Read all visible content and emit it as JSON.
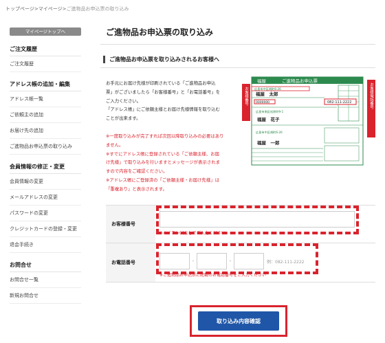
{
  "breadcrumb": {
    "home": "トップページ",
    "mypage": "マイページ",
    "current": "ご進物品お申込票の取り込み",
    "sep": ">"
  },
  "sidebar": {
    "top_button": "マイページトップへ",
    "sections": [
      {
        "title": "ご注文履歴",
        "items": [
          "ご注文履歴"
        ]
      },
      {
        "title": "アドレス帳の追加・編集",
        "items": [
          "アドレス帳一覧",
          "ご依頼主の追加",
          "お届け先の追加",
          "ご進物品お申込票の取り込み"
        ]
      },
      {
        "title": "会員情報の修正・変更",
        "items": [
          "会員情報の変更",
          "メールアドレスの変更",
          "パスワードの変更",
          "クレジットカードの登録・変更",
          "退会手続き"
        ]
      },
      {
        "title": "お問合せ",
        "items": [
          "お問合せ一覧",
          "新規お問合せ"
        ]
      }
    ]
  },
  "main": {
    "title": "ご進物品お申込票の取り込み",
    "subheading": "ご進物品お申込票を取り込みされるお客様へ",
    "description": [
      "お手元にお届け先様が印刷されている「ご進物品お申込",
      "票」がございましたら「お客様番号」と「お電話番号」を",
      "ご入力ください。",
      "「アドレス帳」にご依頼主様とお届け先様情報を取り込む",
      "ことが出来ます。"
    ],
    "notes": [
      "※一度取り込みが完了すれば次回以降取り込みの必要はあり",
      "ません。",
      "※すでにアドレス帳に登録されている「ご依頼主様、お届",
      "け先様」で取り込みを行いますとメッセージが表示されま",
      "すので内容をご確認ください。",
      "※アドレス帳にご登録済の「ご依頼主様・お届け先様」は",
      "「重複あり」と表示されます。"
    ],
    "coupon": {
      "header": "ご進物品お申込票",
      "logo": "福屋",
      "side_left": "お客様番号",
      "side_right": "お客様電話番号",
      "address1": "広島市中区胡町6-26",
      "name1": "福屋　太郎",
      "number": "0000000",
      "phone": "082-111-2222",
      "address2": "広島市南区松原町9-1",
      "name2": "福屋　花子",
      "address3": "広島市中区胡町6-26",
      "name3": "福屋　一郎"
    },
    "form": {
      "customer_label": "お客様番号",
      "customer_hint": "※ハイフン(-)なしでご入力ください",
      "phone_label": "お電話番号",
      "phone_dash": "-",
      "phone_example": "例：082-111-2222",
      "phone_hint": "※ご進物品お申込票に記載のお電話番号をご入力ください"
    },
    "submit_label": "取り込み内容確認"
  },
  "colors": {
    "accent_red": "#d9232d",
    "button_blue": "#1f56a8",
    "coupon_green": "#2d8a4e"
  }
}
